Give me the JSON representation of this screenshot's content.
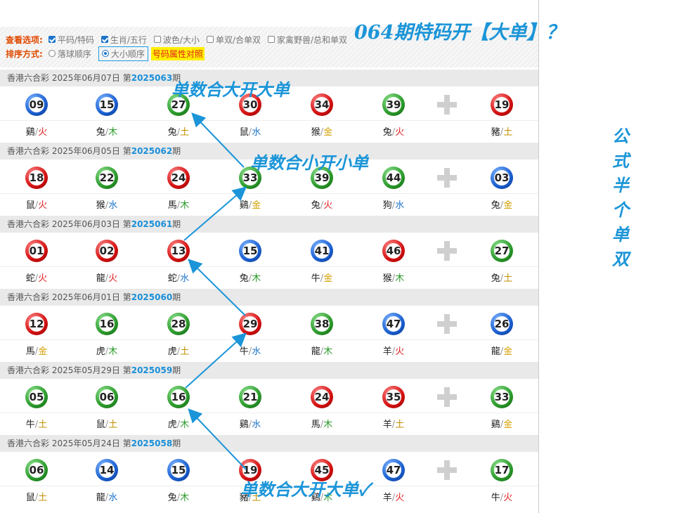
{
  "headline": "064期特码开【大单】？",
  "side_note": [
    "公",
    "式",
    "半",
    "个",
    "单",
    "双"
  ],
  "options": {
    "view_label": "查看选项:",
    "view_items": [
      {
        "label": "平码/特码",
        "checked": true
      },
      {
        "label": "生肖/五行",
        "checked": true
      },
      {
        "label": "波色/大小",
        "checked": false
      },
      {
        "label": "单双/合单双",
        "checked": false
      },
      {
        "label": "家禽野兽/总和单双",
        "checked": false
      }
    ],
    "sort_label": "排序方式:",
    "sort_items": [
      {
        "label": "落球顺序",
        "selected": false
      },
      {
        "label": "大小顺序",
        "selected": true
      }
    ],
    "compare_label": "号码属性对照"
  },
  "annotations": {
    "a1": "单数合大开大单",
    "a2": "单数合小开小单",
    "a3": "单数合大开大单✓"
  },
  "colors": {
    "red": "#d31010",
    "blue": "#1a5fd0",
    "green": "#2b9a2b",
    "accent": "#1b95d8"
  },
  "elements": {
    "火": "#e02020",
    "木": "#2b9a2b",
    "水": "#1a73c8",
    "土": "#c09000",
    "金": "#d4a000"
  },
  "draws": [
    {
      "prefix": "香港六合彩 2025年06月07日 第",
      "period": "2025063",
      "suffix": "期",
      "balls": [
        {
          "num": "09",
          "color": "blue",
          "zodiac": "鷄",
          "element": "火"
        },
        {
          "num": "15",
          "color": "blue",
          "zodiac": "兔",
          "element": "木"
        },
        {
          "num": "27",
          "color": "green",
          "zodiac": "兔",
          "element": "土"
        },
        {
          "num": "30",
          "color": "red",
          "zodiac": "鼠",
          "element": "水"
        },
        {
          "num": "34",
          "color": "red",
          "zodiac": "猴",
          "element": "金"
        },
        {
          "num": "39",
          "color": "green",
          "zodiac": "兔",
          "element": "火"
        }
      ],
      "special": {
        "num": "19",
        "color": "red",
        "zodiac": "豬",
        "element": "土"
      }
    },
    {
      "prefix": "香港六合彩 2025年06月05日 第",
      "period": "2025062",
      "suffix": "期",
      "balls": [
        {
          "num": "18",
          "color": "red",
          "zodiac": "鼠",
          "element": "火"
        },
        {
          "num": "22",
          "color": "green",
          "zodiac": "猴",
          "element": "水"
        },
        {
          "num": "24",
          "color": "red",
          "zodiac": "馬",
          "element": "木"
        },
        {
          "num": "33",
          "color": "green",
          "zodiac": "鷄",
          "element": "金"
        },
        {
          "num": "39",
          "color": "green",
          "zodiac": "兔",
          "element": "火"
        },
        {
          "num": "44",
          "color": "green",
          "zodiac": "狗",
          "element": "水"
        }
      ],
      "special": {
        "num": "03",
        "color": "blue",
        "zodiac": "兔",
        "element": "金"
      }
    },
    {
      "prefix": "香港六合彩 2025年06月03日 第",
      "period": "2025061",
      "suffix": "期",
      "balls": [
        {
          "num": "01",
          "color": "red",
          "zodiac": "蛇",
          "element": "火"
        },
        {
          "num": "02",
          "color": "red",
          "zodiac": "龍",
          "element": "火"
        },
        {
          "num": "13",
          "color": "red",
          "zodiac": "蛇",
          "element": "水"
        },
        {
          "num": "15",
          "color": "blue",
          "zodiac": "兔",
          "element": "木"
        },
        {
          "num": "41",
          "color": "blue",
          "zodiac": "牛",
          "element": "金"
        },
        {
          "num": "46",
          "color": "red",
          "zodiac": "猴",
          "element": "木"
        }
      ],
      "special": {
        "num": "27",
        "color": "green",
        "zodiac": "兔",
        "element": "土"
      }
    },
    {
      "prefix": "香港六合彩 2025年06月01日 第",
      "period": "2025060",
      "suffix": "期",
      "balls": [
        {
          "num": "12",
          "color": "red",
          "zodiac": "馬",
          "element": "金"
        },
        {
          "num": "16",
          "color": "green",
          "zodiac": "虎",
          "element": "木"
        },
        {
          "num": "28",
          "color": "green",
          "zodiac": "虎",
          "element": "土"
        },
        {
          "num": "29",
          "color": "red",
          "zodiac": "牛",
          "element": "水"
        },
        {
          "num": "38",
          "color": "green",
          "zodiac": "龍",
          "element": "木"
        },
        {
          "num": "47",
          "color": "blue",
          "zodiac": "羊",
          "element": "火"
        }
      ],
      "special": {
        "num": "26",
        "color": "blue",
        "zodiac": "龍",
        "element": "金"
      }
    },
    {
      "prefix": "香港六合彩 2025年05月29日 第",
      "period": "2025059",
      "suffix": "期",
      "balls": [
        {
          "num": "05",
          "color": "green",
          "zodiac": "牛",
          "element": "土"
        },
        {
          "num": "06",
          "color": "green",
          "zodiac": "鼠",
          "element": "土"
        },
        {
          "num": "16",
          "color": "green",
          "zodiac": "虎",
          "element": "木"
        },
        {
          "num": "21",
          "color": "green",
          "zodiac": "鷄",
          "element": "水"
        },
        {
          "num": "24",
          "color": "red",
          "zodiac": "馬",
          "element": "木"
        },
        {
          "num": "35",
          "color": "red",
          "zodiac": "羊",
          "element": "土"
        }
      ],
      "special": {
        "num": "33",
        "color": "green",
        "zodiac": "鷄",
        "element": "金"
      }
    },
    {
      "prefix": "香港六合彩 2025年05月24日 第",
      "period": "2025058",
      "suffix": "期",
      "balls": [
        {
          "num": "06",
          "color": "green",
          "zodiac": "鼠",
          "element": "土"
        },
        {
          "num": "14",
          "color": "blue",
          "zodiac": "龍",
          "element": "水"
        },
        {
          "num": "15",
          "color": "blue",
          "zodiac": "兔",
          "element": "木"
        },
        {
          "num": "19",
          "color": "red",
          "zodiac": "豬",
          "element": "土"
        },
        {
          "num": "45",
          "color": "red",
          "zodiac": "鷄",
          "element": "木"
        },
        {
          "num": "47",
          "color": "blue",
          "zodiac": "羊",
          "element": "火"
        }
      ],
      "special": {
        "num": "17",
        "color": "green",
        "zodiac": "牛",
        "element": "火"
      }
    }
  ]
}
